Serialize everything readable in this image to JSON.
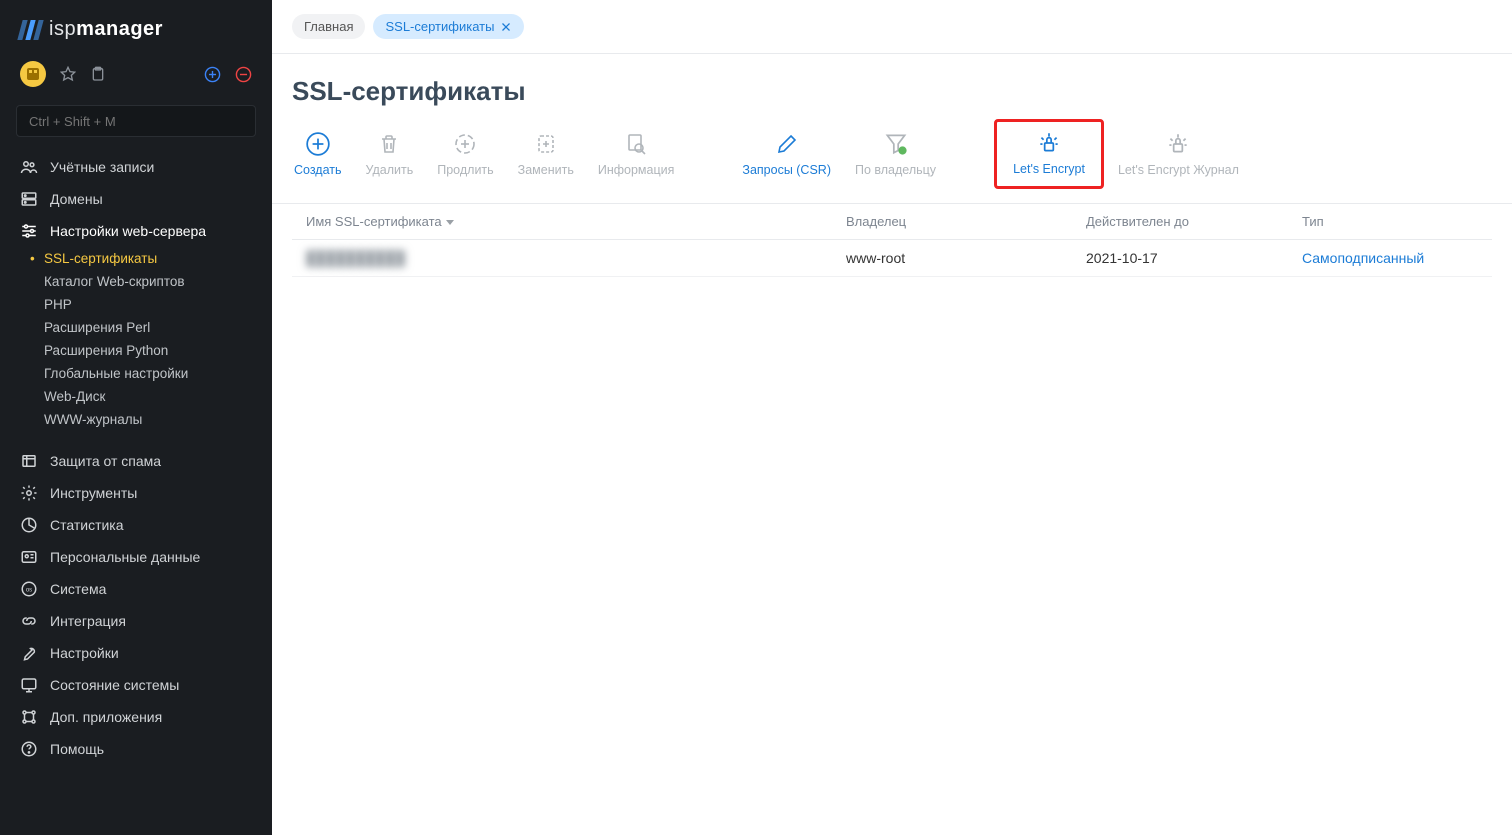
{
  "app": {
    "brand_light": "isp",
    "brand_bold": "manager"
  },
  "sidebar": {
    "search_placeholder": "Ctrl + Shift + M",
    "items": [
      {
        "label": "Учётные записи"
      },
      {
        "label": "Домены"
      },
      {
        "label": "Настройки web-сервера",
        "expanded": true,
        "children": [
          {
            "label": "SSL-сертификаты",
            "active": true
          },
          {
            "label": "Каталог Web-скриптов"
          },
          {
            "label": "PHP"
          },
          {
            "label": "Расширения Perl"
          },
          {
            "label": "Расширения Python"
          },
          {
            "label": "Глобальные настройки"
          },
          {
            "label": "Web-Диск"
          },
          {
            "label": "WWW-журналы"
          }
        ]
      },
      {
        "label": "Защита от спама"
      },
      {
        "label": "Инструменты"
      },
      {
        "label": "Статистика"
      },
      {
        "label": "Персональные данные"
      },
      {
        "label": "Система"
      },
      {
        "label": "Интеграция"
      },
      {
        "label": "Настройки"
      },
      {
        "label": "Состояние системы"
      },
      {
        "label": "Доп. приложения"
      },
      {
        "label": "Помощь"
      }
    ]
  },
  "tabs": [
    {
      "label": "Главная",
      "active": false
    },
    {
      "label": "SSL-сертификаты",
      "active": true
    }
  ],
  "page": {
    "title": "SSL-сертификаты"
  },
  "toolbar": [
    {
      "label": "Создать",
      "enabled": true,
      "icon": "plus-circle"
    },
    {
      "label": "Удалить",
      "enabled": false,
      "icon": "trash"
    },
    {
      "label": "Продлить",
      "enabled": false,
      "icon": "refresh-plus"
    },
    {
      "label": "Заменить",
      "enabled": false,
      "icon": "swap"
    },
    {
      "label": "Информация",
      "enabled": false,
      "icon": "zoom"
    },
    {
      "gap": true
    },
    {
      "label": "Запросы (CSR)",
      "enabled": true,
      "icon": "pen"
    },
    {
      "label": "По владельцу",
      "enabled": false,
      "icon": "funnel-user"
    },
    {
      "gap": true
    },
    {
      "label": "Let's Encrypt",
      "enabled": true,
      "icon": "lock-shine",
      "highlighted": true
    },
    {
      "label": "Let's Encrypt Журнал",
      "enabled": false,
      "icon": "lock-shine"
    }
  ],
  "table": {
    "columns": [
      {
        "label": "Имя SSL-сертификата",
        "sortable": true
      },
      {
        "label": "Владелец"
      },
      {
        "label": "Действителен до"
      },
      {
        "label": "Тип"
      }
    ],
    "rows": [
      {
        "name": "██████████",
        "owner": "www-root",
        "valid_until": "2021-10-17",
        "type": "Самоподписанный"
      }
    ]
  }
}
